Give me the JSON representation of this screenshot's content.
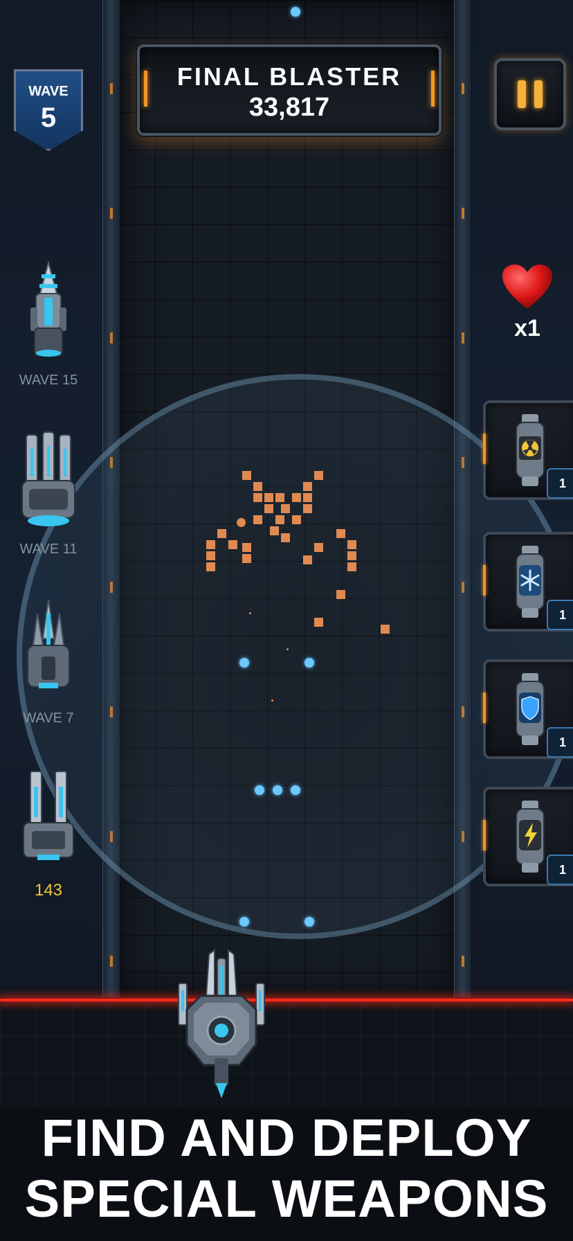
{
  "game": {
    "score_title": "FINAL BLASTER",
    "score_value": "33,817"
  },
  "wave_badge": {
    "label": "WAVE",
    "number": "5"
  },
  "pause_icon": "pause-icon",
  "weapons": [
    {
      "label": "WAVE 15",
      "icon": "drill-cannon-icon"
    },
    {
      "label": "WAVE 11",
      "icon": "triple-barrel-cannon-icon"
    },
    {
      "label": "WAVE 7",
      "icon": "spike-cannon-icon"
    },
    {
      "label": "143",
      "icon": "twin-cannon-icon"
    }
  ],
  "lives": {
    "icon": "heart-icon",
    "count": "x1"
  },
  "powerups": [
    {
      "icon": "radiation-bomb-icon",
      "qty": "1"
    },
    {
      "icon": "freeze-icon",
      "qty": "1"
    },
    {
      "icon": "shield-icon",
      "qty": "1"
    },
    {
      "icon": "lightning-icon",
      "qty": "1"
    }
  ],
  "promo": {
    "line1": "FIND AND DEPLOY",
    "line2": "SPECIAL WEAPONS"
  },
  "colors": {
    "accent_orange": "#f0962b",
    "bullet_blue": "#6cc8ff",
    "enemy_orange": "#e08a52",
    "laser_red": "#ff2a1a",
    "count_gold": "#f2c53a"
  }
}
